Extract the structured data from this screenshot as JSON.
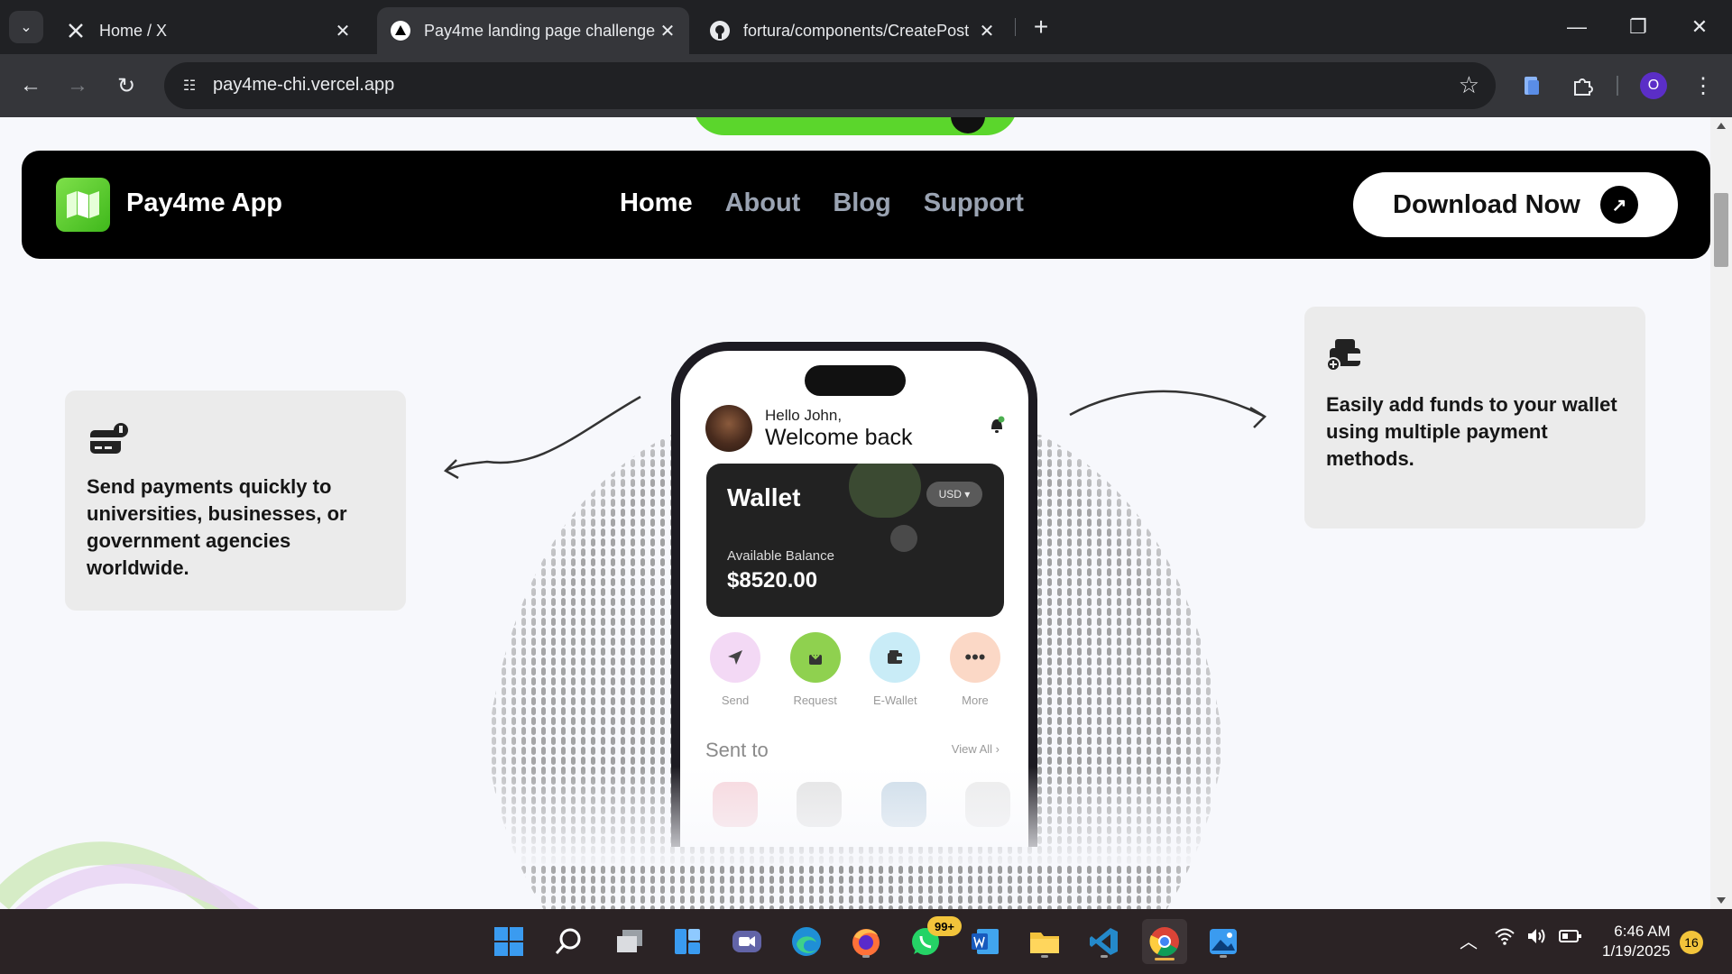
{
  "browser": {
    "tabs": [
      {
        "title": "Home / X",
        "icon": "x-logo-icon"
      },
      {
        "title": "Pay4me landing page challenge",
        "icon": "vercel-triangle-icon"
      },
      {
        "title": "fortura/components/CreatePost",
        "icon": "github-icon"
      }
    ],
    "url": "pay4me-chi.vercel.app",
    "profile_initial": "O"
  },
  "page": {
    "brand": "Pay4me App",
    "nav": [
      "Home",
      "About",
      "Blog",
      "Support"
    ],
    "cta": "Download Now",
    "left_card": "Send payments quickly to universities, businesses, or government agencies worldwide.",
    "right_card": "Easily add funds to your wallet using multiple payment methods.",
    "phone": {
      "hello": "Hello John,",
      "welcome": "Welcome back",
      "wallet_title": "Wallet",
      "currency": "USD ▾",
      "available_label": "Available Balance",
      "balance": "$8520.00",
      "actions": [
        "Send",
        "Request",
        "E-Wallet",
        "More"
      ],
      "sent_to": "Sent to",
      "view_all": "View All ›"
    }
  },
  "taskbar": {
    "whatsapp_badge": "99+",
    "time": "6:46 AM",
    "date": "1/19/2025",
    "notifications": "16"
  },
  "colors": {
    "accent_green": "#5bd62c",
    "navbar": "#000000"
  }
}
